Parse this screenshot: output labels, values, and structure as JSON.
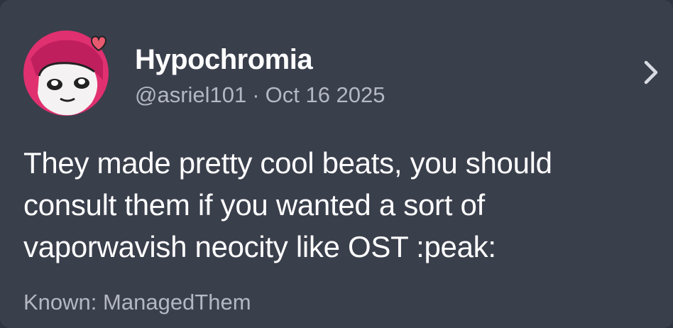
{
  "post": {
    "display_name": "Hypochromia",
    "handle": "@asriel101",
    "separator": "·",
    "date": "Oct 16 2025",
    "body": "They made pretty cool beats, you should consult them if you wanted a sort of vaporwavish neocity like OST :peak:",
    "footer_label": "Known:",
    "footer_value": "ManagedThem"
  },
  "icons": {
    "avatar": "avatar-image",
    "open": "chevron-right-icon"
  },
  "colors": {
    "card_background": "#3a3f4c",
    "primary_text": "#ffffff",
    "secondary_text": "#b3b8c2",
    "avatar_accent": "#e0306f"
  }
}
